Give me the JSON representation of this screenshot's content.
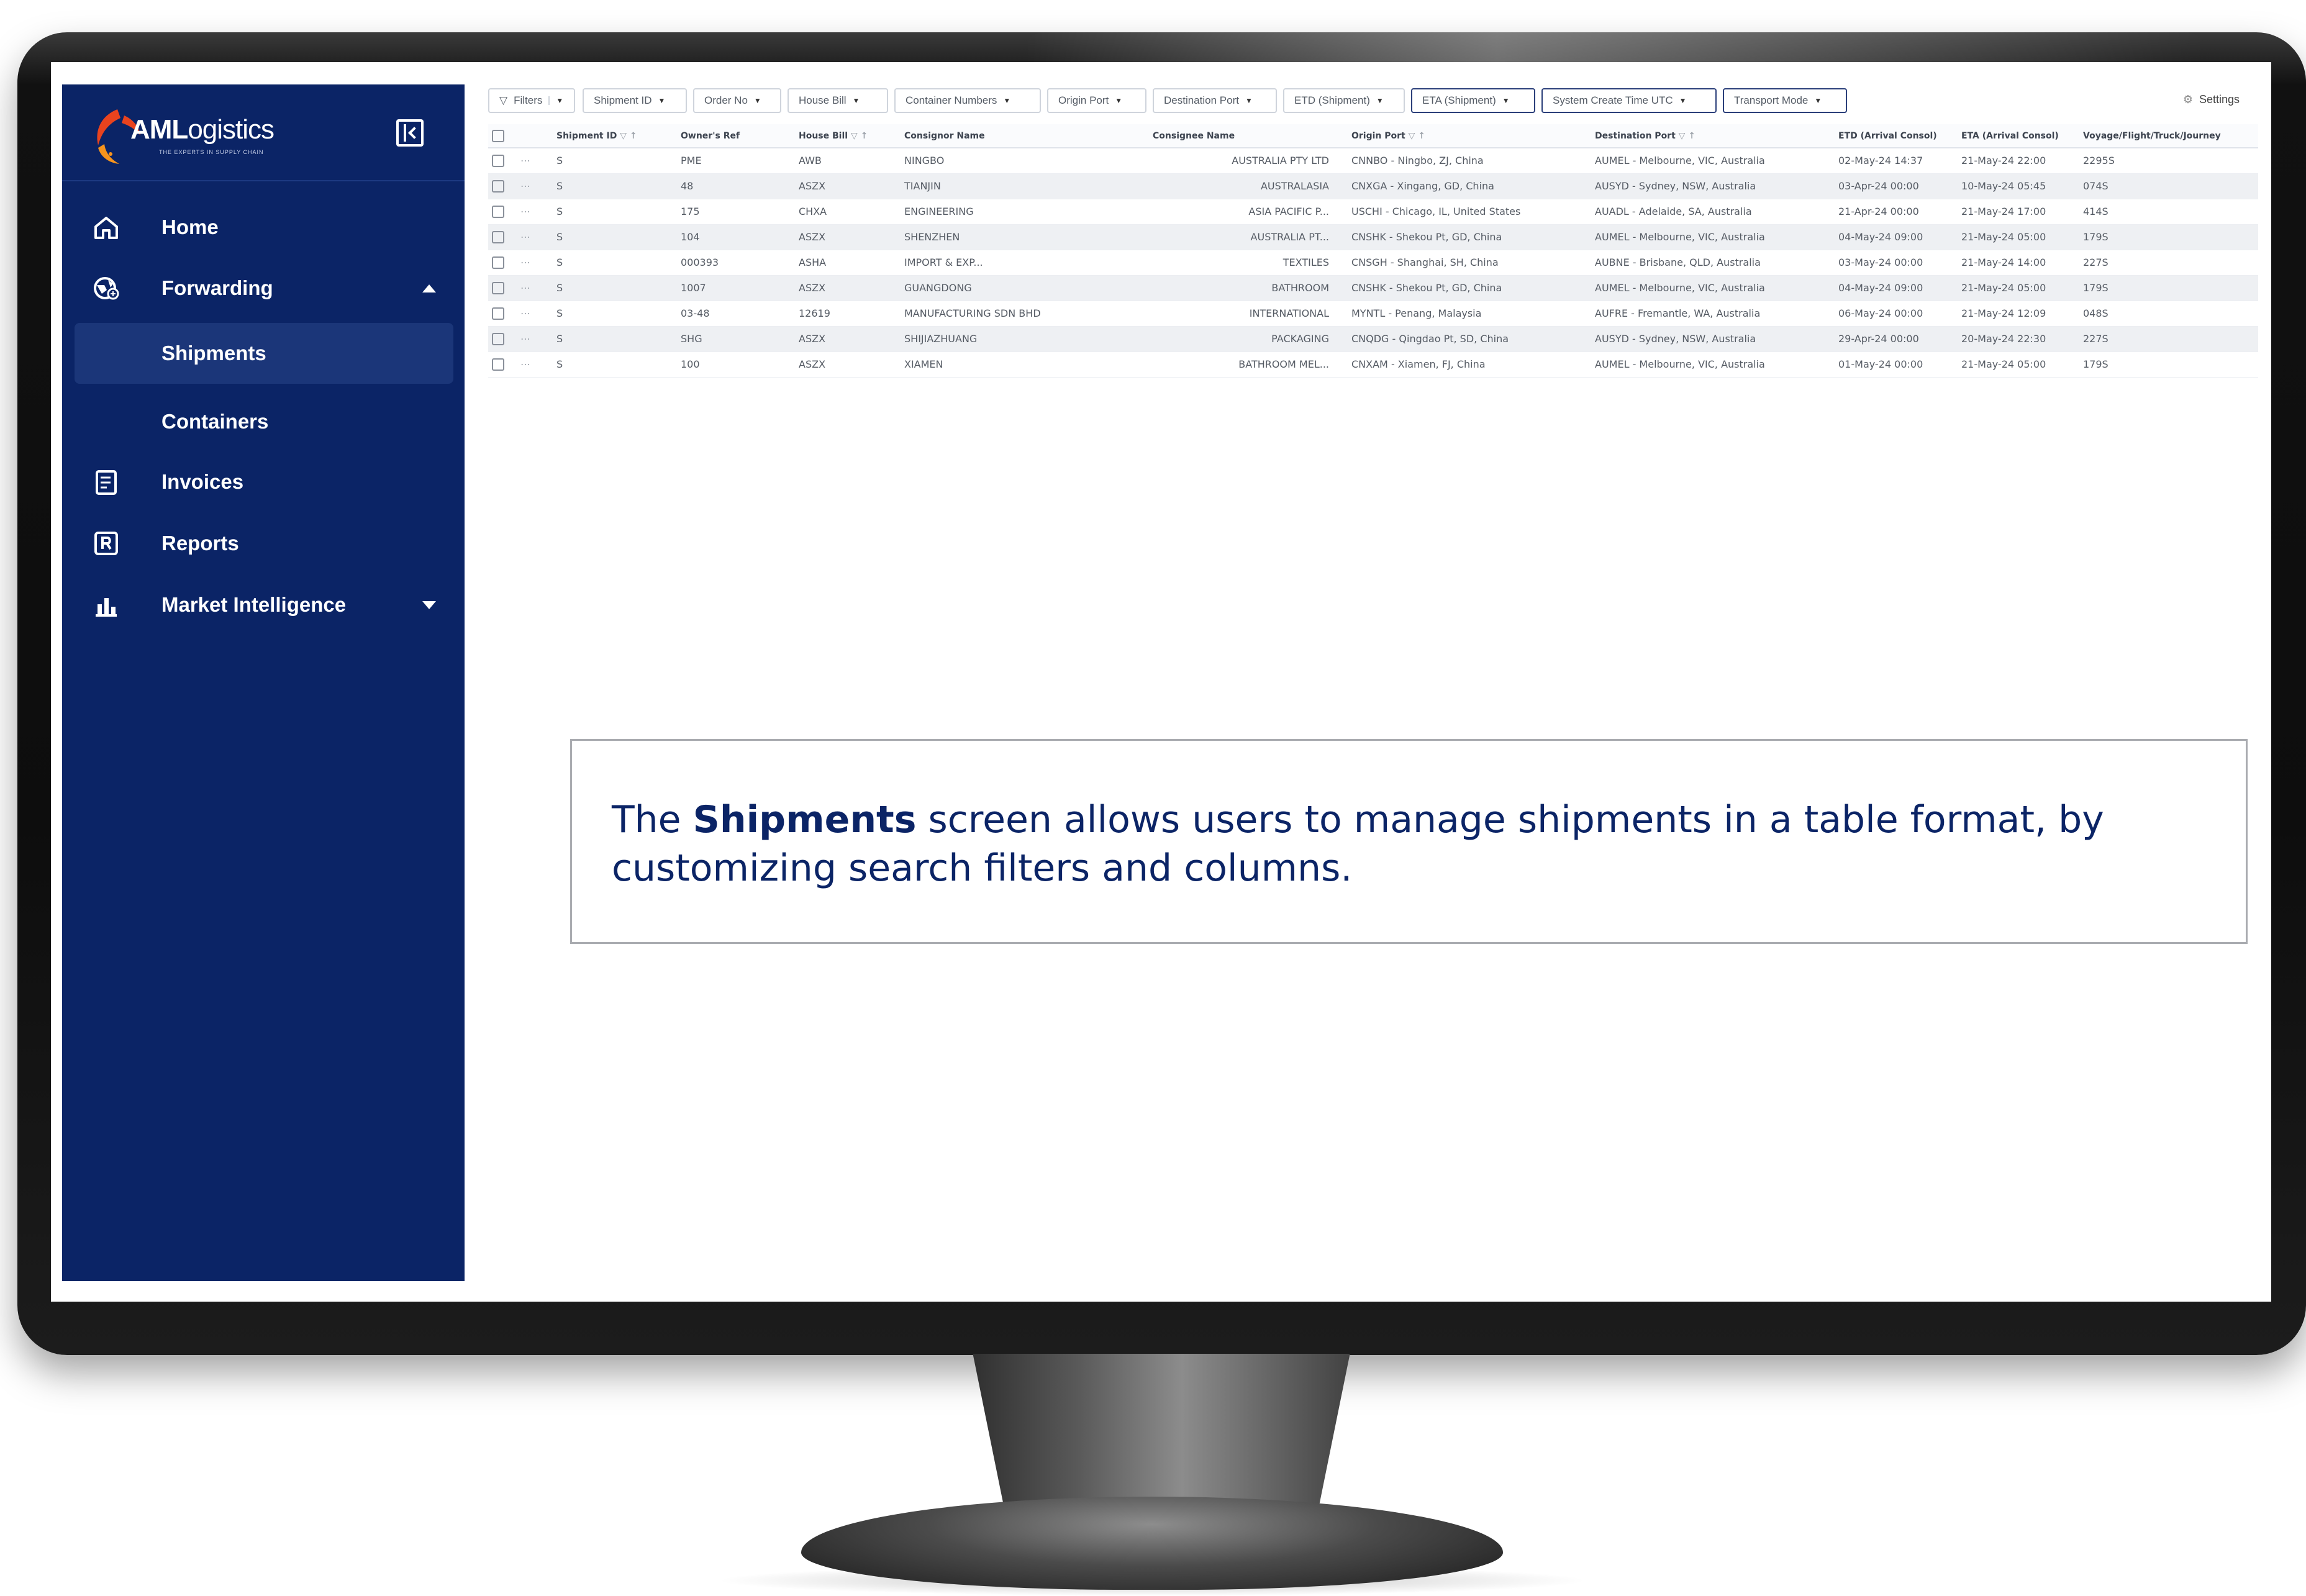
{
  "brand": {
    "name_bold": "AML",
    "name_light": "ogistics",
    "tagline": "THE EXPERTS IN SUPPLY CHAIN",
    "logo_colors": [
      "#e9431e",
      "#f7941d",
      "#ffffff"
    ]
  },
  "sidebar": {
    "bg_color": "#0b2466",
    "items": [
      {
        "label": "Home",
        "icon": "home-icon"
      },
      {
        "label": "Forwarding",
        "icon": "globe-icon",
        "expanded": true
      },
      {
        "label": "Shipments",
        "sub": true,
        "active": true
      },
      {
        "label": "Containers",
        "sub": true
      },
      {
        "label": "Invoices",
        "icon": "invoice-icon"
      },
      {
        "label": "Reports",
        "icon": "reports-icon"
      },
      {
        "label": "Market Intelligence",
        "icon": "bar-chart-icon",
        "expanded": false
      }
    ]
  },
  "toolbar": {
    "filters": [
      "Filters",
      "Shipment ID",
      "Order No",
      "House Bill",
      "Container Numbers",
      "Origin Port",
      "Destination Port",
      "ETD (Shipment)",
      "ETA (Shipment)",
      "System Create Time UTC",
      "Transport Mode"
    ],
    "settings_label": "Settings"
  },
  "table": {
    "columns": [
      "Shipment ID",
      "Owner's Ref",
      "House Bill",
      "Consignor Name",
      "Consignee Name",
      "Origin Port",
      "Destination Port",
      "ETD (Arrival Consol)",
      "ETA (Arrival Consol)",
      "Voyage/Flight/Truck/Journey"
    ],
    "rows": [
      [
        "S",
        "PME",
        "AWB",
        "NINGBO",
        "AUSTRALIA PTY LTD",
        "CNNBO - Ningbo, ZJ, China",
        "AUMEL - Melbourne, VIC, Australia",
        "02-May-24 14:37",
        "21-May-24 22:00",
        "2295S"
      ],
      [
        "S",
        "48",
        "ASZX",
        "TIANJIN",
        "AUSTRALASIA",
        "CNXGA - Xingang, GD, China",
        "AUSYD - Sydney, NSW, Australia",
        "03-Apr-24 00:00",
        "10-May-24 05:45",
        "074S"
      ],
      [
        "S",
        "175",
        "CHXA",
        "ENGINEERING",
        "ASIA PACIFIC P...",
        "USCHI - Chicago, IL, United States",
        "AUADL - Adelaide, SA, Australia",
        "21-Apr-24 00:00",
        "21-May-24 17:00",
        "414S"
      ],
      [
        "S",
        "104",
        "ASZX",
        "SHENZHEN",
        "AUSTRALIA PT...",
        "CNSHK - Shekou Pt, GD, China",
        "AUMEL - Melbourne, VIC, Australia",
        "04-May-24 09:00",
        "21-May-24 05:00",
        "179S"
      ],
      [
        "S",
        "000393",
        "ASHA",
        "IMPORT & EXP...",
        "TEXTILES",
        "CNSGH - Shanghai, SH, China",
        "AUBNE - Brisbane, QLD, Australia",
        "03-May-24 00:00",
        "21-May-24 14:00",
        "227S"
      ],
      [
        "S",
        "1007",
        "ASZX",
        "GUANGDONG",
        "BATHROOM",
        "CNSHK - Shekou Pt, GD, China",
        "AUMEL - Melbourne, VIC, Australia",
        "04-May-24 09:00",
        "21-May-24 05:00",
        "179S"
      ],
      [
        "S",
        "03-48",
        "12619",
        "MANUFACTURING SDN BHD",
        "INTERNATIONAL",
        "MYNTL - Penang, Malaysia",
        "AUFRE - Fremantle, WA, Australia",
        "06-May-24 00:00",
        "21-May-24 12:09",
        "048S"
      ],
      [
        "S",
        "SHG",
        "ASZX",
        "SHIJIAZHUANG",
        "PACKAGING",
        "CNQDG - Qingdao Pt, SD, China",
        "AUSYD - Sydney, NSW, Australia",
        "29-Apr-24 00:00",
        "20-May-24 22:30",
        "227S"
      ],
      [
        "S",
        "100",
        "ASZX",
        "XIAMEN",
        "BATHROOM MEL...",
        "CNXAM - Xiamen, FJ, China",
        "AUMEL - Melbourne, VIC, Australia",
        "01-May-24 00:00",
        "21-May-24 05:00",
        "179S"
      ]
    ]
  },
  "callout": {
    "prefix": "The ",
    "bold": "Shipments",
    "suffix": " screen allows users to manage shipments in a table format, by customizing search filters and columns."
  }
}
